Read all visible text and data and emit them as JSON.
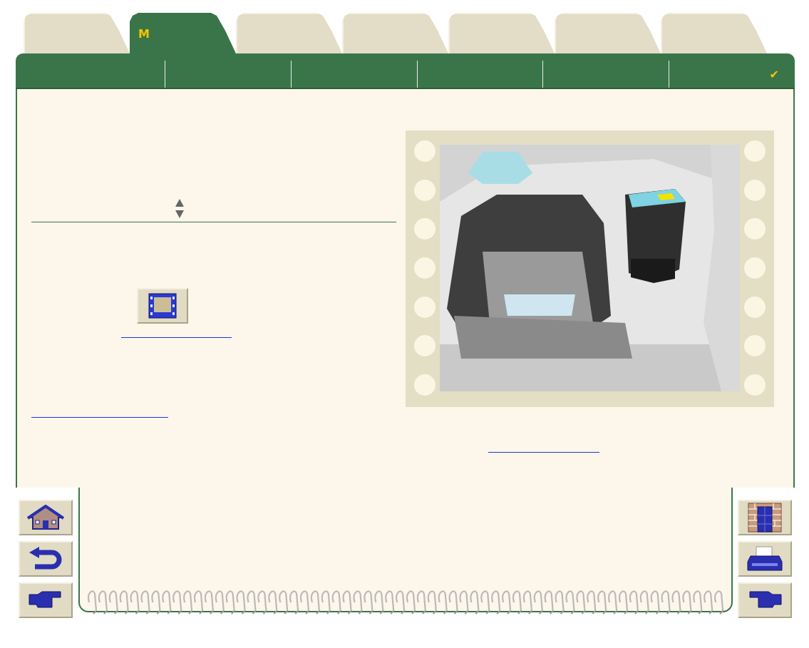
{
  "tabs": [
    {
      "selected": false
    },
    {
      "label": "M",
      "selected": true
    },
    {
      "selected": false
    },
    {
      "selected": false
    },
    {
      "selected": false
    },
    {
      "selected": false
    },
    {
      "selected": false
    }
  ],
  "section_bar": {
    "check": "✔"
  },
  "nav_left": [
    {
      "kind": "home"
    },
    {
      "kind": "back"
    },
    {
      "kind": "next"
    }
  ],
  "nav_right": [
    {
      "kind": "contents"
    },
    {
      "kind": "print"
    },
    {
      "kind": "forward"
    }
  ]
}
